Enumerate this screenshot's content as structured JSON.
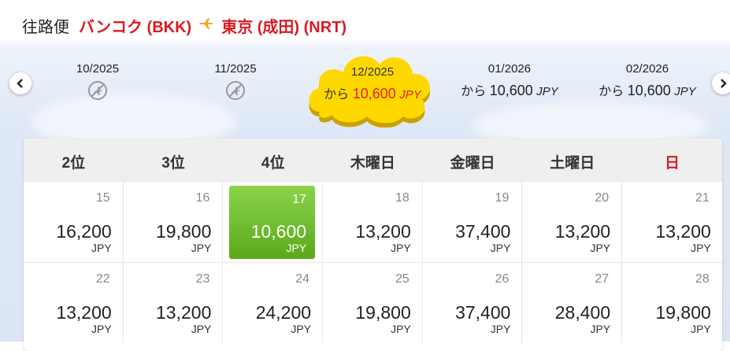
{
  "header": {
    "title": "往路便",
    "origin": "バンコク (BKK)",
    "destination": "東京 (成田) (NRT)"
  },
  "months": [
    {
      "label": "10/2025",
      "available": false
    },
    {
      "label": "11/2025",
      "available": false
    },
    {
      "label": "12/2025",
      "available": true,
      "kara": "から",
      "price": "10,600",
      "currency": "JPY",
      "selected": true
    },
    {
      "label": "01/2026",
      "available": true,
      "kara": "から",
      "price": "10,600",
      "currency": "JPY"
    },
    {
      "label": "02/2026",
      "available": true,
      "kara": "から",
      "price": "10,600",
      "currency": "JPY"
    }
  ],
  "weekdays": [
    "2位",
    "3位",
    "4位",
    "木曜日",
    "金曜日",
    "土曜日",
    "日"
  ],
  "weeks": [
    [
      {
        "day": "15",
        "fare": "16,200",
        "currency": "JPY"
      },
      {
        "day": "16",
        "fare": "19,800",
        "currency": "JPY"
      },
      {
        "day": "17",
        "fare": "10,600",
        "currency": "JPY",
        "selected": true
      },
      {
        "day": "18",
        "fare": "13,200",
        "currency": "JPY"
      },
      {
        "day": "19",
        "fare": "37,400",
        "currency": "JPY"
      },
      {
        "day": "20",
        "fare": "13,200",
        "currency": "JPY"
      },
      {
        "day": "21",
        "fare": "13,200",
        "currency": "JPY"
      }
    ],
    [
      {
        "day": "22",
        "fare": "13,200",
        "currency": "JPY"
      },
      {
        "day": "23",
        "fare": "13,200",
        "currency": "JPY"
      },
      {
        "day": "24",
        "fare": "24,200",
        "currency": "JPY"
      },
      {
        "day": "25",
        "fare": "19,800",
        "currency": "JPY"
      },
      {
        "day": "26",
        "fare": "37,400",
        "currency": "JPY"
      },
      {
        "day": "27",
        "fare": "28,400",
        "currency": "JPY"
      },
      {
        "day": "28",
        "fare": "19,800",
        "currency": "JPY"
      }
    ]
  ],
  "colors": {
    "brand_red": "#d81b23",
    "selected_green": "#6cbf2a",
    "cloud_yellow": "#ffd800"
  }
}
